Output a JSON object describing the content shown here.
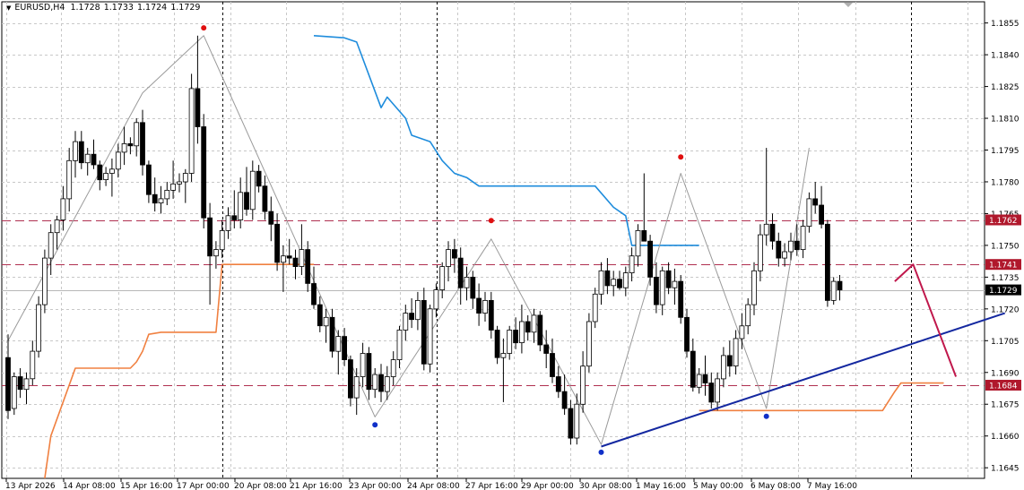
{
  "header": {
    "menu_icon": "triangle-down-icon",
    "symbol": "EURUSD,H4",
    "open": "1.1728",
    "high": "1.1733",
    "low": "1.1724",
    "close": "1.1729"
  },
  "colors": {
    "background": "#ffffff",
    "grid": "#c8c8c8",
    "candle_up": "#ffffff",
    "candle_down": "#000000",
    "level_line": "#b03050",
    "price_label": "#b0182c",
    "current_label": "#000000",
    "zigzag": "#9a9a9a",
    "trend_line": "#1428a0",
    "blue_line": "#1e8cdc",
    "orange_line": "#f08040",
    "projection": "#c0184c",
    "fractal_top": "#e01010",
    "fractal_bottom": "#1030c8"
  },
  "chart_data": {
    "type": "candlestick",
    "symbol": "EURUSD",
    "timeframe": "H4",
    "ylim": [
      1.164,
      1.1865
    ],
    "y_ticks": [
      "1.1855",
      "1.1840",
      "1.1825",
      "1.1810",
      "1.1795",
      "1.1780",
      "1.1765",
      "1.1750",
      "1.1735",
      "1.1720",
      "1.1705",
      "1.1690",
      "1.1675",
      "1.1660",
      "1.1645"
    ],
    "x_labels": [
      "13 Apr 2026",
      "14 Apr 08:00",
      "15 Apr 16:00",
      "17 Apr 00:00",
      "20 Apr 08:00",
      "21 Apr 16:00",
      "23 Apr 00:00",
      "24 Apr 08:00",
      "27 Apr 16:00",
      "29 Apr 00:00",
      "30 Apr 08:00",
      "1 May 16:00",
      "5 May 00:00",
      "6 May 08:00",
      "7 May 16:00"
    ],
    "price_levels": [
      {
        "value": 1.1762,
        "label": "1.1762"
      },
      {
        "value": 1.1741,
        "label": "1.1741"
      },
      {
        "value": 1.1684,
        "label": "1.1684"
      }
    ],
    "current_price": {
      "value": 1.1729,
      "label": "1.1729"
    },
    "ohlc": [
      [
        1.1697,
        1.1708,
        1.1668,
        1.1672
      ],
      [
        1.1673,
        1.169,
        1.167,
        1.1688
      ],
      [
        1.1688,
        1.1692,
        1.1678,
        1.1682
      ],
      [
        1.1682,
        1.169,
        1.1675,
        1.1687
      ],
      [
        1.1687,
        1.1705,
        1.1684,
        1.17
      ],
      [
        1.17,
        1.1726,
        1.1697,
        1.1722
      ],
      [
        1.1722,
        1.1748,
        1.1718,
        1.1744
      ],
      [
        1.1744,
        1.176,
        1.1736,
        1.1756
      ],
      [
        1.1756,
        1.1764,
        1.1748,
        1.1762
      ],
      [
        1.1762,
        1.1778,
        1.1757,
        1.1772
      ],
      [
        1.1772,
        1.1796,
        1.1766,
        1.179
      ],
      [
        1.179,
        1.1804,
        1.1782,
        1.1799
      ],
      [
        1.1799,
        1.1804,
        1.1786,
        1.1789
      ],
      [
        1.1789,
        1.1796,
        1.1783,
        1.1793
      ],
      [
        1.1793,
        1.18,
        1.1786,
        1.1788
      ],
      [
        1.1788,
        1.179,
        1.1776,
        1.1781
      ],
      [
        1.1781,
        1.1787,
        1.1778,
        1.1784
      ],
      [
        1.1784,
        1.1791,
        1.1773,
        1.1786
      ],
      [
        1.1786,
        1.1798,
        1.1782,
        1.1794
      ],
      [
        1.1794,
        1.1806,
        1.1788,
        1.1798
      ],
      [
        1.1798,
        1.1801,
        1.1793,
        1.1797
      ],
      [
        1.1797,
        1.181,
        1.1792,
        1.1808
      ],
      [
        1.1808,
        1.1814,
        1.1783,
        1.1788
      ],
      [
        1.1788,
        1.179,
        1.177,
        1.1774
      ],
      [
        1.1774,
        1.1782,
        1.1766,
        1.177
      ],
      [
        1.177,
        1.1778,
        1.1765,
        1.1772
      ],
      [
        1.1772,
        1.178,
        1.1769,
        1.1776
      ],
      [
        1.1776,
        1.179,
        1.1772,
        1.1779
      ],
      [
        1.1779,
        1.1784,
        1.1775,
        1.178
      ],
      [
        1.178,
        1.1786,
        1.177,
        1.1784
      ],
      [
        1.1784,
        1.1831,
        1.178,
        1.1824
      ],
      [
        1.1824,
        1.1849,
        1.1798,
        1.1806
      ],
      [
        1.1806,
        1.1812,
        1.1758,
        1.1763
      ],
      [
        1.1763,
        1.177,
        1.1722,
        1.1745
      ],
      [
        1.1745,
        1.1752,
        1.1739,
        1.1748
      ],
      [
        1.1748,
        1.1762,
        1.1744,
        1.1757
      ],
      [
        1.1757,
        1.1768,
        1.1753,
        1.1764
      ],
      [
        1.1764,
        1.1776,
        1.1758,
        1.1762
      ],
      [
        1.1762,
        1.1782,
        1.1758,
        1.1775
      ],
      [
        1.1775,
        1.1787,
        1.1764,
        1.1767
      ],
      [
        1.1767,
        1.179,
        1.1762,
        1.1785
      ],
      [
        1.1785,
        1.1788,
        1.1775,
        1.1778
      ],
      [
        1.1778,
        1.1783,
        1.1762,
        1.1766
      ],
      [
        1.1766,
        1.1773,
        1.1752,
        1.176
      ],
      [
        1.176,
        1.1765,
        1.1738,
        1.1742
      ],
      [
        1.1742,
        1.175,
        1.1728,
        1.1745
      ],
      [
        1.1745,
        1.1753,
        1.1741,
        1.1744
      ],
      [
        1.1744,
        1.1748,
        1.1734,
        1.174
      ],
      [
        1.174,
        1.176,
        1.1736,
        1.1748
      ],
      [
        1.1748,
        1.1752,
        1.1728,
        1.1732
      ],
      [
        1.1732,
        1.174,
        1.172,
        1.1722
      ],
      [
        1.1722,
        1.1726,
        1.1709,
        1.1712
      ],
      [
        1.1712,
        1.172,
        1.1704,
        1.1716
      ],
      [
        1.1716,
        1.172,
        1.1697,
        1.17
      ],
      [
        1.17,
        1.171,
        1.1689,
        1.1707
      ],
      [
        1.1707,
        1.1711,
        1.1693,
        1.1696
      ],
      [
        1.1696,
        1.1698,
        1.1674,
        1.1678
      ],
      [
        1.1678,
        1.1692,
        1.167,
        1.1688
      ],
      [
        1.1688,
        1.1704,
        1.1683,
        1.1699
      ],
      [
        1.1699,
        1.1702,
        1.1677,
        1.1682
      ],
      [
        1.1682,
        1.1692,
        1.1678,
        1.1689
      ],
      [
        1.1689,
        1.1694,
        1.1676,
        1.1681
      ],
      [
        1.1681,
        1.1693,
        1.1677,
        1.1688
      ],
      [
        1.1688,
        1.17,
        1.1684,
        1.1696
      ],
      [
        1.1696,
        1.1712,
        1.1692,
        1.171
      ],
      [
        1.171,
        1.1722,
        1.1705,
        1.1718
      ],
      [
        1.1718,
        1.1725,
        1.1711,
        1.1715
      ],
      [
        1.1715,
        1.1728,
        1.171,
        1.1724
      ],
      [
        1.1724,
        1.173,
        1.1691,
        1.1694
      ],
      [
        1.1694,
        1.1722,
        1.169,
        1.172
      ],
      [
        1.172,
        1.1732,
        1.1716,
        1.1729
      ],
      [
        1.1729,
        1.1742,
        1.1725,
        1.174
      ],
      [
        1.174,
        1.1752,
        1.1733,
        1.1748
      ],
      [
        1.1748,
        1.1753,
        1.1737,
        1.1744
      ],
      [
        1.1744,
        1.1749,
        1.1722,
        1.173
      ],
      [
        1.173,
        1.174,
        1.1724,
        1.1735
      ],
      [
        1.1735,
        1.1738,
        1.172,
        1.1725
      ],
      [
        1.1725,
        1.1732,
        1.1712,
        1.1718
      ],
      [
        1.1718,
        1.1728,
        1.1714,
        1.1724
      ],
      [
        1.1724,
        1.1728,
        1.1706,
        1.171
      ],
      [
        1.171,
        1.1712,
        1.1694,
        1.1697
      ],
      [
        1.1697,
        1.1706,
        1.1676,
        1.1699
      ],
      [
        1.1699,
        1.1712,
        1.1696,
        1.171
      ],
      [
        1.171,
        1.1716,
        1.1701,
        1.1704
      ],
      [
        1.1704,
        1.1722,
        1.1699,
        1.1714
      ],
      [
        1.1714,
        1.1717,
        1.1705,
        1.1709
      ],
      [
        1.1709,
        1.172,
        1.1704,
        1.1717
      ],
      [
        1.1717,
        1.1719,
        1.17,
        1.1703
      ],
      [
        1.1703,
        1.171,
        1.1692,
        1.1699
      ],
      [
        1.1699,
        1.1706,
        1.1685,
        1.1688
      ],
      [
        1.1688,
        1.1693,
        1.1678,
        1.1681
      ],
      [
        1.1681,
        1.1689,
        1.167,
        1.1673
      ],
      [
        1.1673,
        1.1677,
        1.1656,
        1.1659
      ],
      [
        1.1659,
        1.168,
        1.1656,
        1.1675
      ],
      [
        1.1675,
        1.17,
        1.1671,
        1.1693
      ],
      [
        1.1693,
        1.1718,
        1.169,
        1.1714
      ],
      [
        1.1714,
        1.173,
        1.1711,
        1.1727
      ],
      [
        1.1727,
        1.1742,
        1.1722,
        1.1738
      ],
      [
        1.1738,
        1.1744,
        1.1727,
        1.1731
      ],
      [
        1.1731,
        1.1738,
        1.1726,
        1.1734
      ],
      [
        1.1734,
        1.1738,
        1.1729,
        1.173
      ],
      [
        1.173,
        1.174,
        1.1726,
        1.1737
      ],
      [
        1.1737,
        1.1749,
        1.1733,
        1.1745
      ],
      [
        1.1745,
        1.176,
        1.174,
        1.1757
      ],
      [
        1.1757,
        1.1784,
        1.1752,
        1.1752
      ],
      [
        1.1752,
        1.1755,
        1.1731,
        1.1735
      ],
      [
        1.1735,
        1.1742,
        1.1718,
        1.1722
      ],
      [
        1.1722,
        1.174,
        1.1717,
        1.1738
      ],
      [
        1.1738,
        1.1742,
        1.1727,
        1.173
      ],
      [
        1.173,
        1.1739,
        1.1722,
        1.1733
      ],
      [
        1.1733,
        1.1736,
        1.1713,
        1.1716
      ],
      [
        1.1716,
        1.172,
        1.1697,
        1.17
      ],
      [
        1.17,
        1.1706,
        1.1681,
        1.1683
      ],
      [
        1.1683,
        1.1692,
        1.168,
        1.1689
      ],
      [
        1.1689,
        1.1698,
        1.1679,
        1.1685
      ],
      [
        1.1685,
        1.169,
        1.1673,
        1.1676
      ],
      [
        1.1676,
        1.169,
        1.1672,
        1.1687
      ],
      [
        1.1687,
        1.1702,
        1.1683,
        1.1698
      ],
      [
        1.1698,
        1.1705,
        1.1688,
        1.1693
      ],
      [
        1.1693,
        1.171,
        1.1689,
        1.1706
      ],
      [
        1.1706,
        1.1718,
        1.1701,
        1.1712
      ],
      [
        1.1712,
        1.1725,
        1.1708,
        1.1722
      ],
      [
        1.1722,
        1.1742,
        1.1717,
        1.1738
      ],
      [
        1.1738,
        1.176,
        1.1733,
        1.1755
      ],
      [
        1.1755,
        1.1796,
        1.175,
        1.176
      ],
      [
        1.176,
        1.1765,
        1.1748,
        1.1752
      ],
      [
        1.1752,
        1.1756,
        1.174,
        1.1744
      ],
      [
        1.1744,
        1.1751,
        1.174,
        1.1747
      ],
      [
        1.1747,
        1.1756,
        1.1743,
        1.1752
      ],
      [
        1.1752,
        1.176,
        1.1745,
        1.1748
      ],
      [
        1.1748,
        1.1762,
        1.1744,
        1.1759
      ],
      [
        1.1759,
        1.1775,
        1.1756,
        1.1772
      ],
      [
        1.1772,
        1.178,
        1.1765,
        1.1769
      ],
      [
        1.1769,
        1.1778,
        1.1758,
        1.176
      ],
      [
        1.176,
        1.1762,
        1.1721,
        1.1724
      ],
      [
        1.1724,
        1.1735,
        1.1722,
        1.1733
      ],
      [
        1.1733,
        1.1736,
        1.1724,
        1.1729
      ]
    ],
    "zigzag": [
      [
        0,
        1.1705
      ],
      [
        22,
        1.1822
      ],
      [
        32,
        1.1849
      ],
      [
        60,
        1.1669
      ],
      [
        79,
        1.1753
      ],
      [
        97,
        1.1656
      ],
      [
        110,
        1.1784
      ],
      [
        124,
        1.1673
      ],
      [
        131,
        1.1796
      ]
    ],
    "fractals_top": [
      [
        32,
        1.1851
      ],
      [
        79,
        1.176
      ],
      [
        110,
        1.179
      ]
    ],
    "fractals_bottom": [
      [
        60,
        1.1667
      ],
      [
        97,
        1.1654
      ],
      [
        124,
        1.1671
      ]
    ],
    "trend_line": [
      [
        97,
        1.1655
      ],
      [
        163,
        1.1718
      ]
    ],
    "projection": [
      [
        145,
        1.1733
      ],
      [
        148,
        1.1741
      ],
      [
        155,
        1.1688
      ]
    ],
    "blue_line": [
      [
        50,
        1.1849
      ],
      [
        55,
        1.1848
      ],
      [
        57,
        1.1846
      ],
      [
        61,
        1.1815
      ],
      [
        62,
        1.182
      ],
      [
        65,
        1.181
      ],
      [
        66,
        1.1802
      ],
      [
        69,
        1.1799
      ],
      [
        71,
        1.179
      ],
      [
        73,
        1.1784
      ],
      [
        75,
        1.1782
      ],
      [
        77,
        1.1778
      ],
      [
        93,
        1.1778
      ],
      [
        96,
        1.1778
      ],
      [
        99,
        1.1768
      ],
      [
        101,
        1.1764
      ],
      [
        102,
        1.175
      ],
      [
        113,
        1.175
      ]
    ],
    "orange_upper": [
      [
        6,
        1.164
      ],
      [
        7,
        1.166
      ],
      [
        11,
        1.1692
      ],
      [
        20,
        1.1692
      ],
      [
        21,
        1.1695
      ],
      [
        22,
        1.17
      ],
      [
        23,
        1.1708
      ],
      [
        25,
        1.1709
      ],
      [
        34,
        1.1709
      ],
      [
        35,
        1.1741
      ],
      [
        50,
        1.1741
      ]
    ],
    "orange_lower": [
      [
        113,
        1.1672
      ],
      [
        143,
        1.1672
      ],
      [
        145,
        1.1681
      ],
      [
        146,
        1.1685
      ],
      [
        153,
        1.1685
      ]
    ]
  },
  "axis": {
    "current_box_text": "1.1729"
  }
}
